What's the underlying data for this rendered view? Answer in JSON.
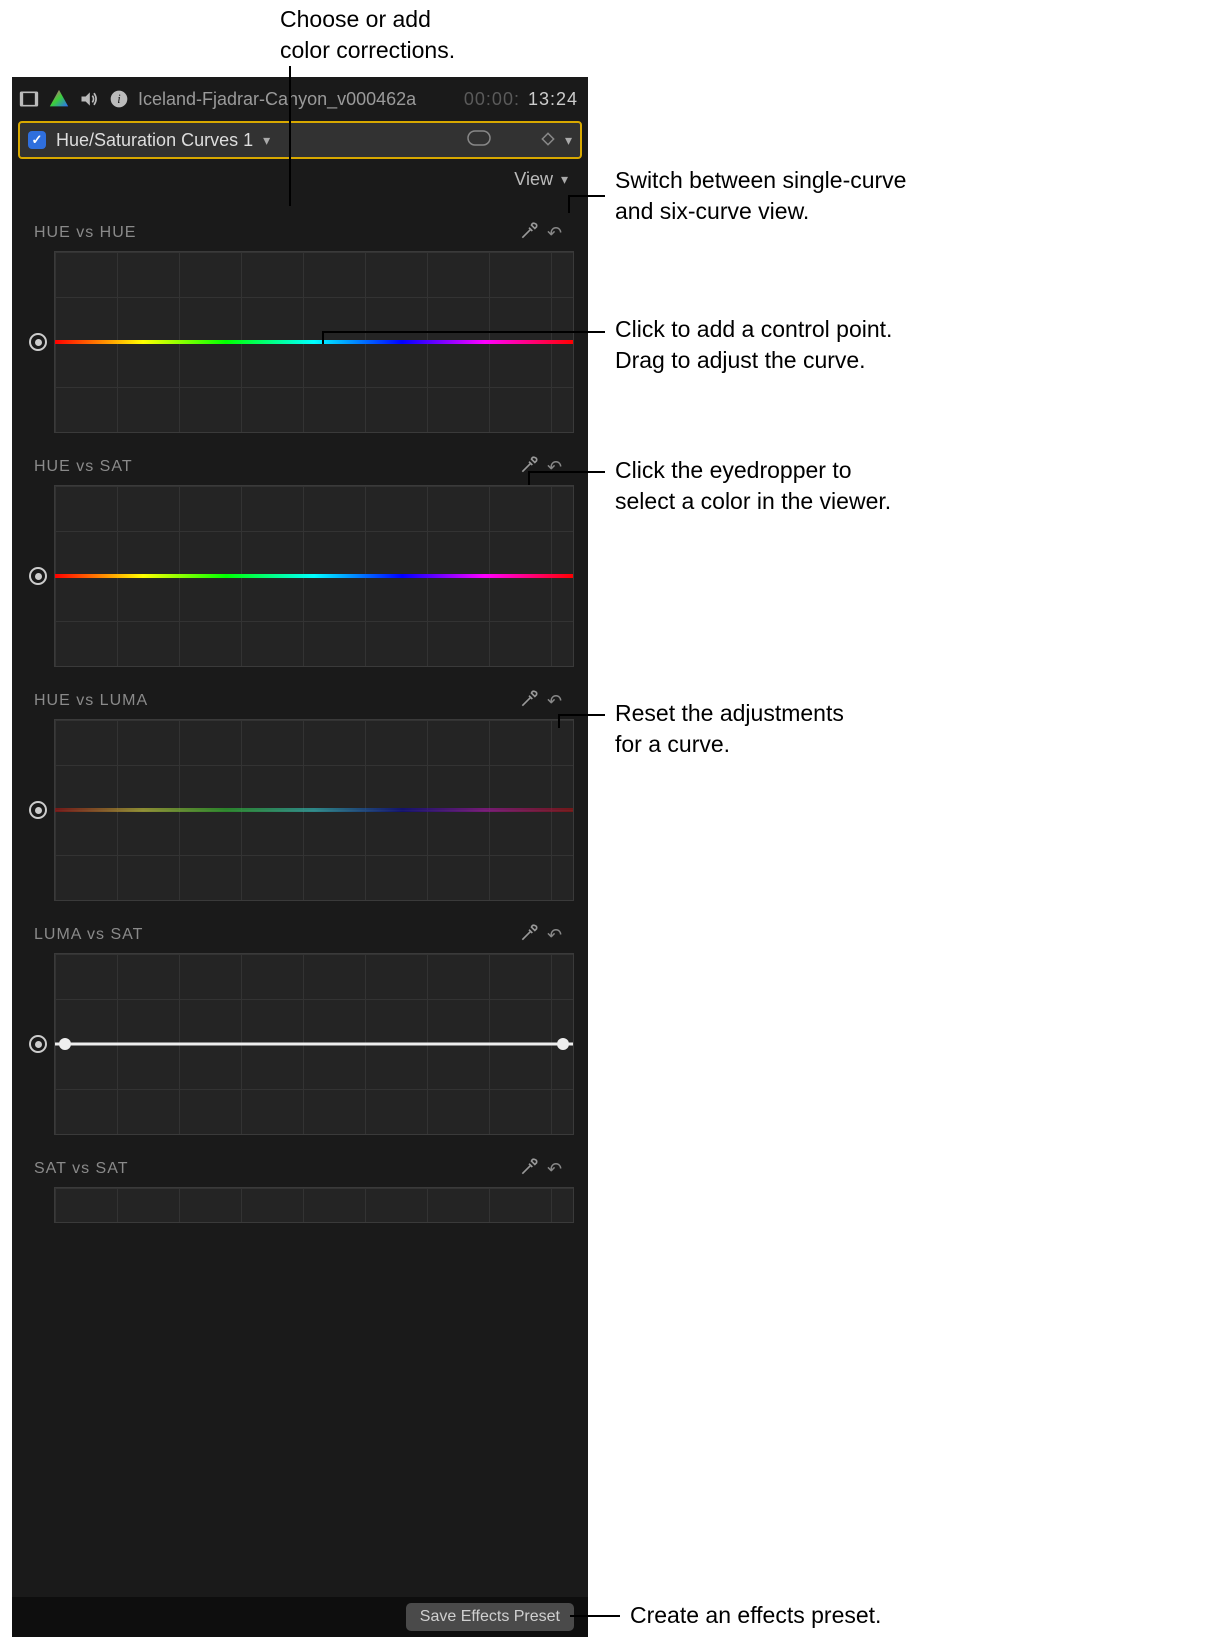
{
  "annotations": {
    "top": "Choose or add\ncolor corrections.",
    "view": "Switch between single-curve\nand six-curve view.",
    "curve": "Click to add a control point.\nDrag to adjust the curve.",
    "eyedropper": "Click the eyedropper to\nselect a color in the viewer.",
    "reset": "Reset the adjustments\nfor a curve.",
    "preset": "Create an effects preset."
  },
  "header": {
    "clip_name": "Iceland-Fjadrar-Canyon_v000462a",
    "timecode_prefix": "00:00:",
    "timecode": "13:24"
  },
  "selector": {
    "checkbox_checked": true,
    "name": "Hue/Saturation Curves 1"
  },
  "view_menu": {
    "label": "View"
  },
  "curves": [
    {
      "title": "HUE vs HUE",
      "line": "hue",
      "dim": false
    },
    {
      "title": "HUE vs SAT",
      "line": "hue",
      "dim": false
    },
    {
      "title": "HUE vs LUMA",
      "line": "hue",
      "dim": true
    },
    {
      "title": "LUMA vs SAT",
      "line": "white",
      "dim": false
    },
    {
      "title": "SAT vs SAT",
      "line": "none",
      "dim": false
    }
  ],
  "footer": {
    "save_label": "Save Effects Preset"
  },
  "icons": {
    "film": "film-icon",
    "color": "color-icon",
    "volume": "volume-icon",
    "info": "info-icon",
    "mask": "mask-icon",
    "keyframe": "keyframe-diamond-icon",
    "eyedropper": "eyedropper-icon",
    "reset": "reset-arrow-icon",
    "chevron": "chevron-down-icon",
    "check": "checkmark-icon"
  }
}
